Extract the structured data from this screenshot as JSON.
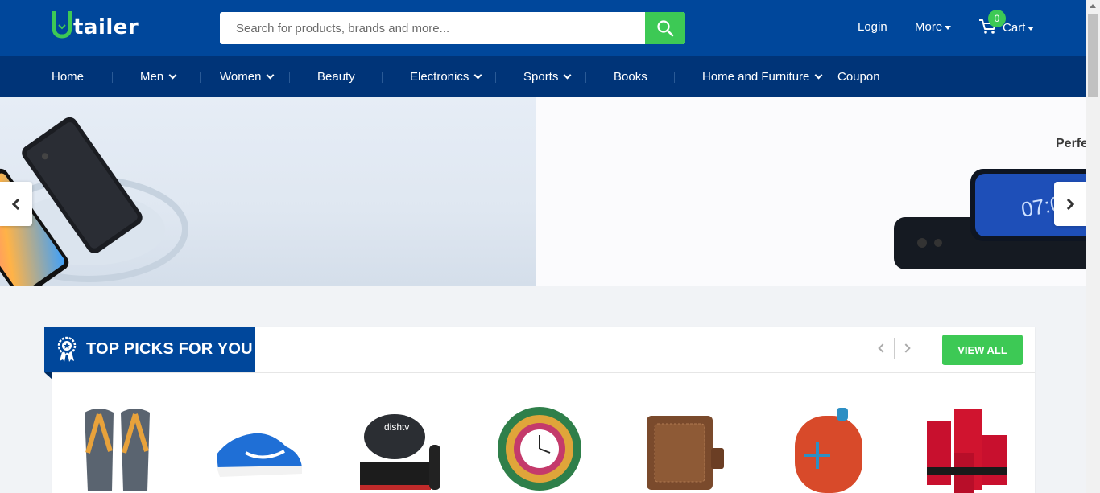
{
  "header": {
    "logo": {
      "letter": "U",
      "text": "tailer"
    },
    "search": {
      "placeholder": "Search for products, brands and more..."
    },
    "login_label": "Login",
    "more_label": "More",
    "cart": {
      "label": "Cart",
      "count": "0"
    }
  },
  "nav": {
    "items": [
      {
        "label": "Home"
      },
      {
        "label": "Men"
      },
      {
        "label": "Women"
      },
      {
        "label": "Beauty"
      },
      {
        "label": "Electronics"
      },
      {
        "label": "Sports"
      },
      {
        "label": "Books"
      },
      {
        "label": "Home and Furniture"
      },
      {
        "label": "Coupon"
      }
    ]
  },
  "banner": {
    "right_text": "Perfe"
  },
  "top_picks": {
    "title": "TOP PICKS FOR YOU",
    "view_all_label": "VIEW ALL",
    "products": [
      {
        "icon": "flip-flops-image"
      },
      {
        "icon": "sneaker-image"
      },
      {
        "icon": "dish-tv-image",
        "brand": "dishtv"
      },
      {
        "icon": "peacock-wall-clock-image"
      },
      {
        "icon": "leather-wallet-image"
      },
      {
        "icon": "bluetooth-speaker-image"
      },
      {
        "icon": "red-candles-image"
      }
    ]
  },
  "colors": {
    "header_bg": "#00479b",
    "nav_bg": "#003478",
    "accent_green": "#3dc955"
  }
}
